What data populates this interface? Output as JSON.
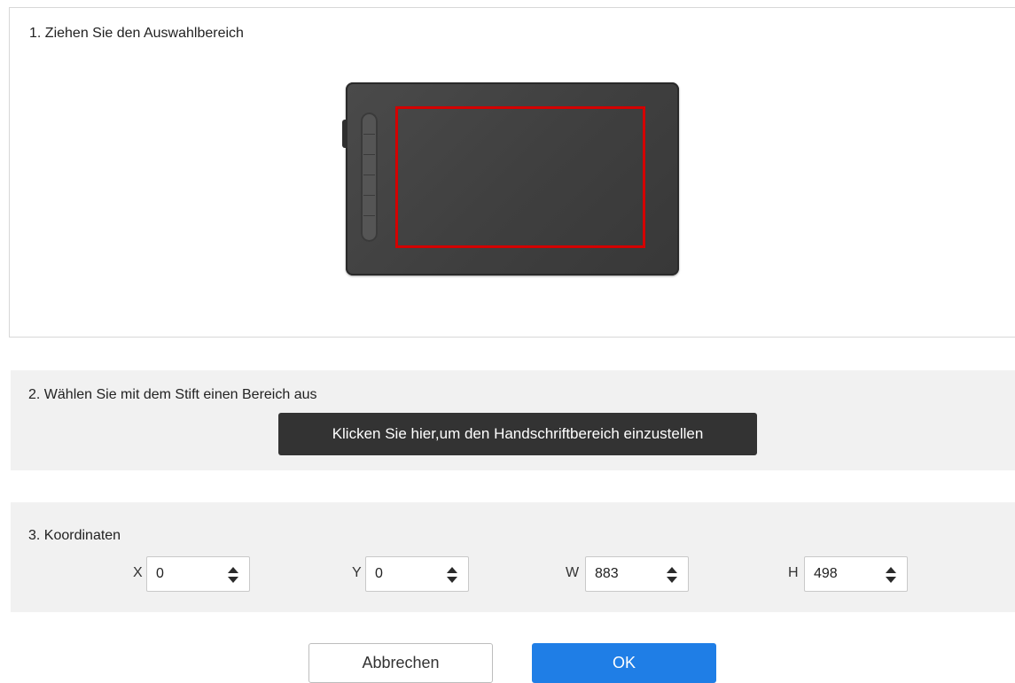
{
  "section1": {
    "title": "1. Ziehen Sie den Auswahlbereich"
  },
  "section2": {
    "title": "2. Wählen Sie mit dem Stift einen Bereich aus",
    "button_label": "Klicken Sie hier,um den Handschriftbereich einzustellen"
  },
  "section3": {
    "title": "3. Koordinaten",
    "fields": [
      {
        "label": "X",
        "value": "0"
      },
      {
        "label": "Y",
        "value": "0"
      },
      {
        "label": "W",
        "value": "883"
      },
      {
        "label": "H",
        "value": "498"
      }
    ]
  },
  "footer": {
    "cancel_label": "Abbrechen",
    "ok_label": "OK"
  },
  "colors": {
    "selection_border": "#d40000",
    "primary_button": "#1f7ee6",
    "tooltip_button": "#333333",
    "panel_bg": "#f1f1f1"
  },
  "icons": {
    "tablet": "pen-tablet-illustration",
    "spinner": "up-down-arrows-icon"
  }
}
